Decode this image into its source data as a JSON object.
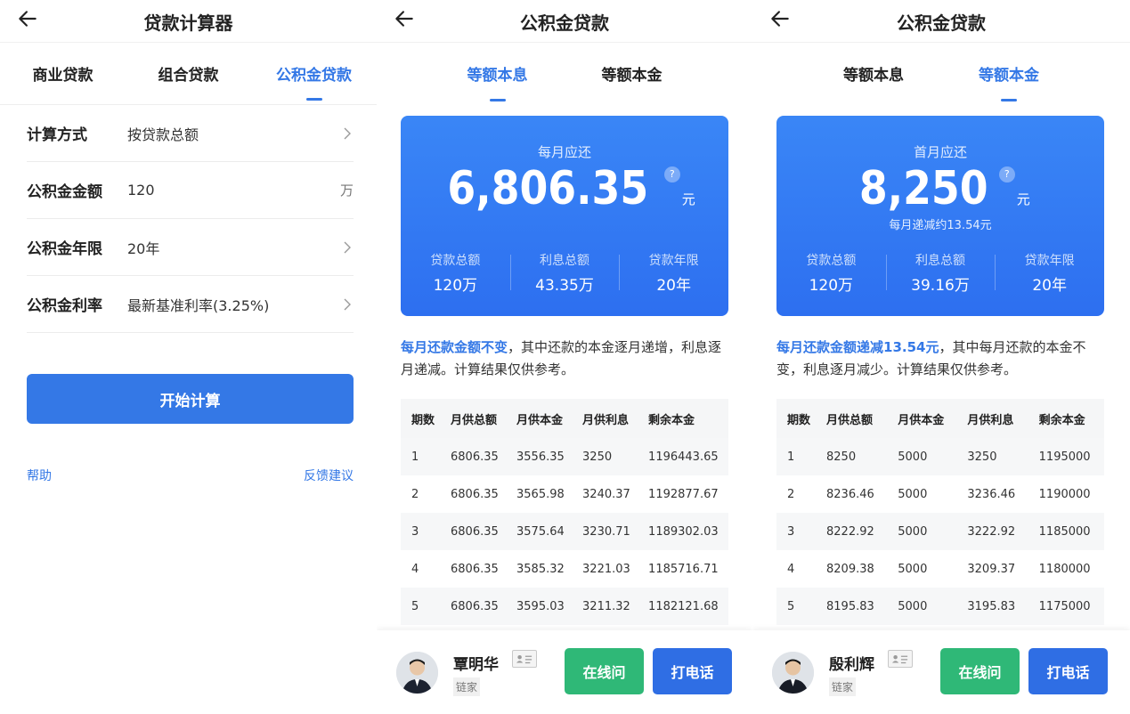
{
  "colors": {
    "accent": "#3478e6",
    "card": "#2d6ff0",
    "chat_button": "#2fb877",
    "call_button": "#2f6ee4"
  },
  "screen1": {
    "title": "贷款计算器",
    "tabs": [
      {
        "label": "商业贷款",
        "active": false
      },
      {
        "label": "组合贷款",
        "active": false
      },
      {
        "label": "公积金贷款",
        "active": true
      }
    ],
    "rows": [
      {
        "label": "计算方式",
        "value": "按贷款总额",
        "suffix": "chevron"
      },
      {
        "label": "公积金金额",
        "value": "120",
        "suffix": "万"
      },
      {
        "label": "公积金年限",
        "value": "20年",
        "suffix": "chevron"
      },
      {
        "label": "公积金利率",
        "value": "最新基准利率(3.25%)",
        "suffix": "chevron"
      }
    ],
    "calc_button": "开始计算",
    "help": "帮助",
    "feedback": "反馈建议"
  },
  "screen2": {
    "title": "公积金贷款",
    "tabs": [
      {
        "label": "等额本息",
        "active": true
      },
      {
        "label": "等额本金",
        "active": false
      }
    ],
    "card": {
      "caption": "每月应还",
      "amount": "6,806.35",
      "unit": "元",
      "help": "?",
      "stats": [
        {
          "k": "贷款总额",
          "v": "120万"
        },
        {
          "k": "利息总额",
          "v": "43.35万"
        },
        {
          "k": "贷款年限",
          "v": "20年"
        }
      ]
    },
    "desc_highlight": "每月还款金额不变",
    "desc_rest": "，其中还款的本金逐月递增，利息逐月递减。计算结果仅供参考。",
    "table": {
      "headers": [
        "期数",
        "月供总额",
        "月供本金",
        "月供利息",
        "剩余本金"
      ],
      "rows": [
        [
          "1",
          "6806.35",
          "3556.35",
          "3250",
          "1196443.65"
        ],
        [
          "2",
          "6806.35",
          "3565.98",
          "3240.37",
          "1192877.67"
        ],
        [
          "3",
          "6806.35",
          "3575.64",
          "3230.71",
          "1189302.03"
        ],
        [
          "4",
          "6806.35",
          "3585.32",
          "3221.03",
          "1185716.71"
        ],
        [
          "5",
          "6806.35",
          "3595.03",
          "3211.32",
          "1182121.68"
        ]
      ]
    },
    "agent": {
      "name": "覃明华",
      "org": "链家",
      "chat": "在线问",
      "call": "打电话"
    }
  },
  "screen3": {
    "title": "公积金贷款",
    "tabs": [
      {
        "label": "等额本息",
        "active": false
      },
      {
        "label": "等额本金",
        "active": true
      }
    ],
    "card": {
      "caption": "首月应还",
      "amount": "8,250",
      "unit": "元",
      "help": "?",
      "subline": "每月递减约13.54元",
      "stats": [
        {
          "k": "贷款总额",
          "v": "120万"
        },
        {
          "k": "利息总额",
          "v": "39.16万"
        },
        {
          "k": "贷款年限",
          "v": "20年"
        }
      ]
    },
    "desc_highlight": "每月还款金额递减13.54元",
    "desc_rest": "，其中每月还款的本金不变，利息逐月减少。计算结果仅供参考。",
    "table": {
      "headers": [
        "期数",
        "月供总额",
        "月供本金",
        "月供利息",
        "剩余本金"
      ],
      "rows": [
        [
          "1",
          "8250",
          "5000",
          "3250",
          "1195000"
        ],
        [
          "2",
          "8236.46",
          "5000",
          "3236.46",
          "1190000"
        ],
        [
          "3",
          "8222.92",
          "5000",
          "3222.92",
          "1185000"
        ],
        [
          "4",
          "8209.38",
          "5000",
          "3209.37",
          "1180000"
        ],
        [
          "5",
          "8195.83",
          "5000",
          "3195.83",
          "1175000"
        ]
      ]
    },
    "agent": {
      "name": "殷利辉",
      "org": "链家",
      "chat": "在线问",
      "call": "打电话"
    }
  }
}
